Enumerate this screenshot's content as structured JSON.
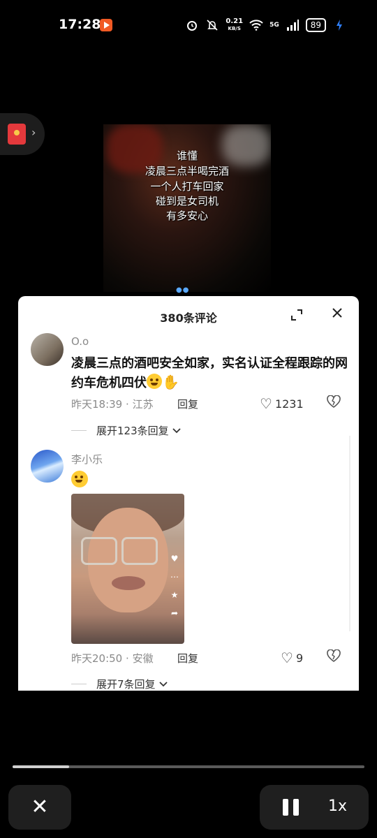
{
  "status_bar": {
    "time": "17:28",
    "net_speed_value": "0.21",
    "net_speed_unit": "KB/S",
    "signal_label": "5G",
    "battery": "89",
    "icons": [
      "alarm-icon",
      "mute-icon",
      "wifi-icon",
      "signal-icon",
      "battery-icon",
      "charging-icon"
    ]
  },
  "video": {
    "caption_lines": [
      "谁懂",
      "凌晨三点半喝完酒",
      "一个人打车回家",
      "碰到是女司机",
      "有多安心"
    ]
  },
  "comments_panel": {
    "title": "380条评论",
    "comments": [
      {
        "username": "O.o",
        "text": "凌晨三点的酒吧安全如家，实名认证全程跟踪的网约车危机四伏",
        "time": "昨天18:39",
        "location": "江苏",
        "separator": "·",
        "reply_label": "回复",
        "likes": "1231",
        "expand_label": "展开123条回复"
      },
      {
        "username": "李小乐",
        "time": "昨天20:50",
        "location": "安徽",
        "separator": "·",
        "reply_label": "回复",
        "likes": "9",
        "expand_label": "展开7条回复"
      }
    ]
  },
  "controls": {
    "close_symbol": "✕",
    "speed_label": "1x",
    "progress": 0.16
  },
  "colors": {
    "background": "#000000",
    "sheet": "#ffffff",
    "red_envelope": "#e4393c",
    "secondary_text": "#8a8a8a"
  }
}
